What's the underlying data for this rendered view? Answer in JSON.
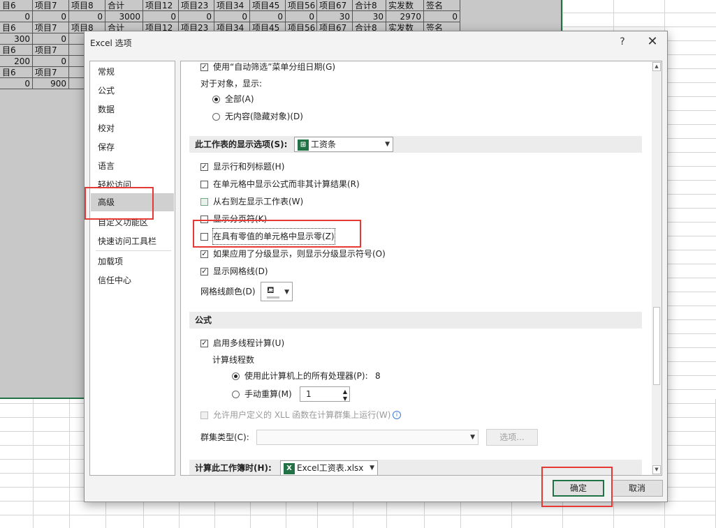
{
  "sheet": {
    "rows": [
      [
        "目6",
        "项目7",
        "项目8",
        "合计",
        "项目12",
        "项目23",
        "项目34",
        "项目45",
        "项目56",
        "项目67",
        "合计8",
        "实发数",
        "签名"
      ],
      [
        "0",
        "0",
        "0",
        "3000",
        "0",
        "0",
        "0",
        "0",
        "0",
        "30",
        "30",
        "2970",
        "0"
      ],
      [
        "目6",
        "项目7",
        "项目8",
        "合计",
        "项目12",
        "项目23",
        "项目34",
        "项目45",
        "项目56",
        "项目67",
        "合计8",
        "实发数",
        "签名"
      ],
      [
        "300",
        "0",
        "",
        "",
        "",
        "",
        "",
        "",
        "",
        "",
        "",
        "",
        ""
      ],
      [
        "目6",
        "项目7",
        "",
        "",
        "",
        "",
        "",
        "",
        "",
        "",
        "",
        "",
        ""
      ],
      [
        "200",
        "0",
        "",
        "",
        "",
        "",
        "",
        "",
        "",
        "",
        "",
        "",
        ""
      ],
      [
        "目6",
        "项目7",
        "",
        "",
        "",
        "",
        "",
        "",
        "",
        "",
        "",
        "",
        ""
      ],
      [
        "0",
        "900",
        "",
        "",
        "",
        "",
        "",
        "",
        "",
        "",
        "",
        "",
        ""
      ]
    ]
  },
  "dialog": {
    "title": "Excel 选项",
    "help": "?",
    "close": "✕"
  },
  "nav": {
    "items": [
      "常规",
      "公式",
      "数据",
      "校对",
      "保存",
      "语言",
      "轻松访问",
      "高级",
      "自定义功能区",
      "快速访问工具栏",
      "加载项",
      "信任中心"
    ],
    "selected": "高级"
  },
  "content": {
    "group_dates": "使用“自动筛选”菜单分组日期(G)",
    "objects_label": "对于对象，显示:",
    "objects_all": "全部(A)",
    "objects_none": "无内容(隐藏对象)(D)",
    "sheet_section": "此工作表的显示选项(S):",
    "sheet_select": "工资条",
    "opt_headers": "显示行和列标题(H)",
    "opt_formulas": "在单元格中显示公式而非其计算结果(R)",
    "opt_rtl": "从右到左显示工作表(W)",
    "opt_pagebreaks": "显示分页符(K)",
    "opt_zero": "在具有零值的单元格中显示零(Z)",
    "opt_outline": "如果应用了分级显示，则显示分级显示符号(O)",
    "opt_gridlines": "显示网格线(D)",
    "gridline_color": "网格线颜色(D)",
    "formula_section": "公式",
    "opt_multithread": "启用多线程计算(U)",
    "threads_label": "计算线程数",
    "threads_all": "使用此计算机上的所有处理器(P):",
    "threads_count": "8",
    "threads_manual": "手动重算(M)",
    "threads_manual_value": "1",
    "opt_xll": "允许用户定义的 XLL 函数在计算群集上运行(W)",
    "cluster_label": "群集类型(C):",
    "cluster_btn": "选项...",
    "calc_section": "计算此工作簿时(H):",
    "calc_select": "Excel工资表.xlsx"
  },
  "footer": {
    "ok": "确定",
    "cancel": "取消"
  },
  "colors": {
    "excel_green": "#217346",
    "highlight_red": "#e53935"
  }
}
